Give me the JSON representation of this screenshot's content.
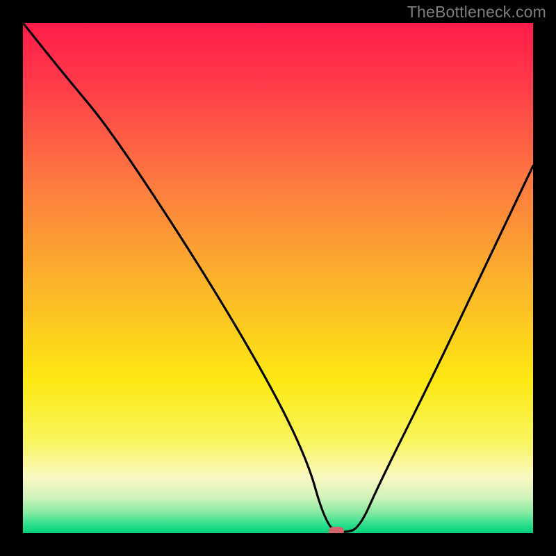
{
  "credit": "TheBottleneck.com",
  "chart_data": {
    "type": "line",
    "title": "",
    "xlabel": "",
    "ylabel": "",
    "xlim": [
      0,
      100
    ],
    "ylim": [
      0,
      100
    ],
    "series": [
      {
        "name": "bottleneck-curve",
        "x": [
          0,
          8,
          18,
          40,
          55,
          59.5,
          63,
          66,
          70,
          80,
          90,
          100
        ],
        "values": [
          100,
          90,
          78,
          44,
          17,
          1,
          0,
          1,
          10,
          30,
          51,
          72
        ]
      }
    ],
    "marker": {
      "x": 61.5,
      "y": 0.4,
      "color": "#d4656c"
    }
  },
  "gradient_stops": [
    {
      "offset": 0,
      "color": "#ff1c4a"
    },
    {
      "offset": 0.12,
      "color": "#ff3b49"
    },
    {
      "offset": 0.3,
      "color": "#fd7641"
    },
    {
      "offset": 0.5,
      "color": "#fcb12c"
    },
    {
      "offset": 0.7,
      "color": "#fde812"
    },
    {
      "offset": 0.82,
      "color": "#f9f65e"
    },
    {
      "offset": 0.89,
      "color": "#faf8c2"
    },
    {
      "offset": 0.93,
      "color": "#d1f3bb"
    },
    {
      "offset": 0.96,
      "color": "#86eaa2"
    },
    {
      "offset": 0.985,
      "color": "#27df8c"
    },
    {
      "offset": 1.0,
      "color": "#04cf7a"
    }
  ]
}
